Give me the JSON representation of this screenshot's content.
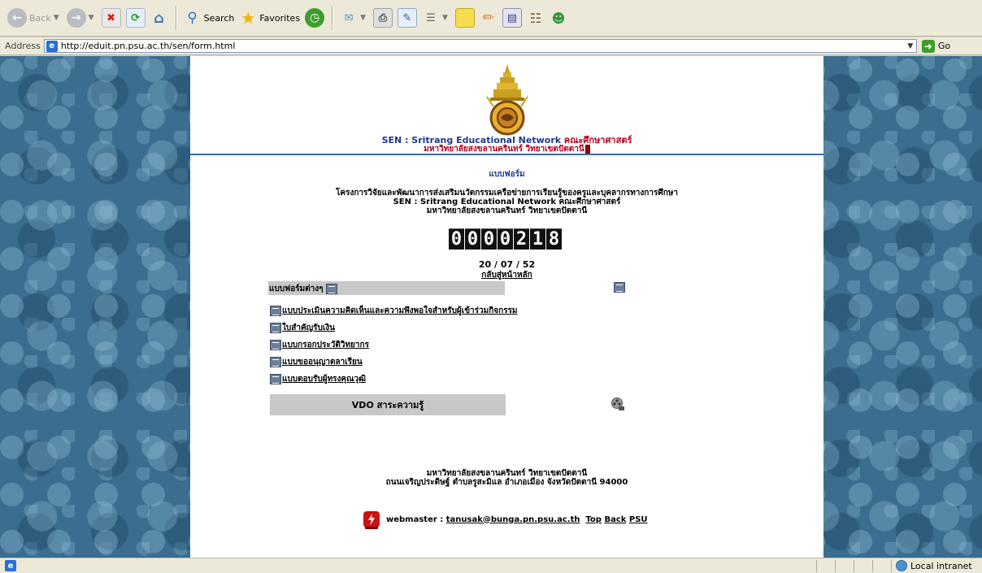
{
  "browser": {
    "toolbar": {
      "back_label": "Back",
      "search_label": "Search",
      "favorites_label": "Favorites"
    },
    "address": {
      "label": "Address",
      "url": "http://eduit.pn.psu.ac.th/sen/form.html",
      "go_label": "Go"
    },
    "status": {
      "zone": "Local intranet"
    }
  },
  "page": {
    "header_line1_en": "SEN : Sritrang Educational Network",
    "header_line1_th": "คณะศึกษาศาสตร์",
    "header_line2": "มหาวิทยาลัยสงขลานครินทร์ วิทยาเขตปัตตานี",
    "form_title": "แบบฟอร์ม",
    "project_line1": "โครงการวิจัยและพัฒนาการส่งเสริมนวัตกรรมเครือข่ายการเรียนรู้ของครูและบุคลากรทางการศึกษา",
    "project_line2": "SEN : Sritrang Educational Network คณะศึกษาศาสตร์",
    "project_line3": "มหาวิทยาลัยสงขลานครินทร์ วิทยาเขตปัตตานี",
    "counter_digits": [
      "0",
      "0",
      "0",
      "0",
      "2",
      "1",
      "8"
    ],
    "date": "20 / 07 / 52",
    "back_home": "กลับสู่หน้าหลัก",
    "forms_section_label": "แบบฟอร์มต่างๆ",
    "form_links": [
      "แบบประเมินความคิดเห็นและความพึงพอใจสำหรับผู้เข้าร่วมกิจกรรม",
      "ใบสำคัญรับเงิน",
      "แบบกรอกประวัติวิทยากร",
      "แบบขออนุญาตลาเรียน",
      "แบบตอบรับผู้ทรงคุณวุฒิ"
    ],
    "vdo_label": "VDO สาระความรู้",
    "footer_line1": "มหาวิทยาลัยสงขลานครินทร์ วิทยาเขตปัตตานี",
    "footer_line2": "ถนนเจริญประดิษฐ์ ตำบลรูสะมิแล อำเภอเมือง จังหวัดปัตตานี 94000",
    "webmaster_label": "webmaster :",
    "webmaster_email": "tanusak@bunga.pn.psu.ac.th",
    "link_top": "Top",
    "link_back": "Back",
    "link_psu": "PSU"
  },
  "colors": {
    "header_blue": "#1a3a8c",
    "header_red": "#b00020",
    "background_pattern": "#3a6d8e"
  }
}
